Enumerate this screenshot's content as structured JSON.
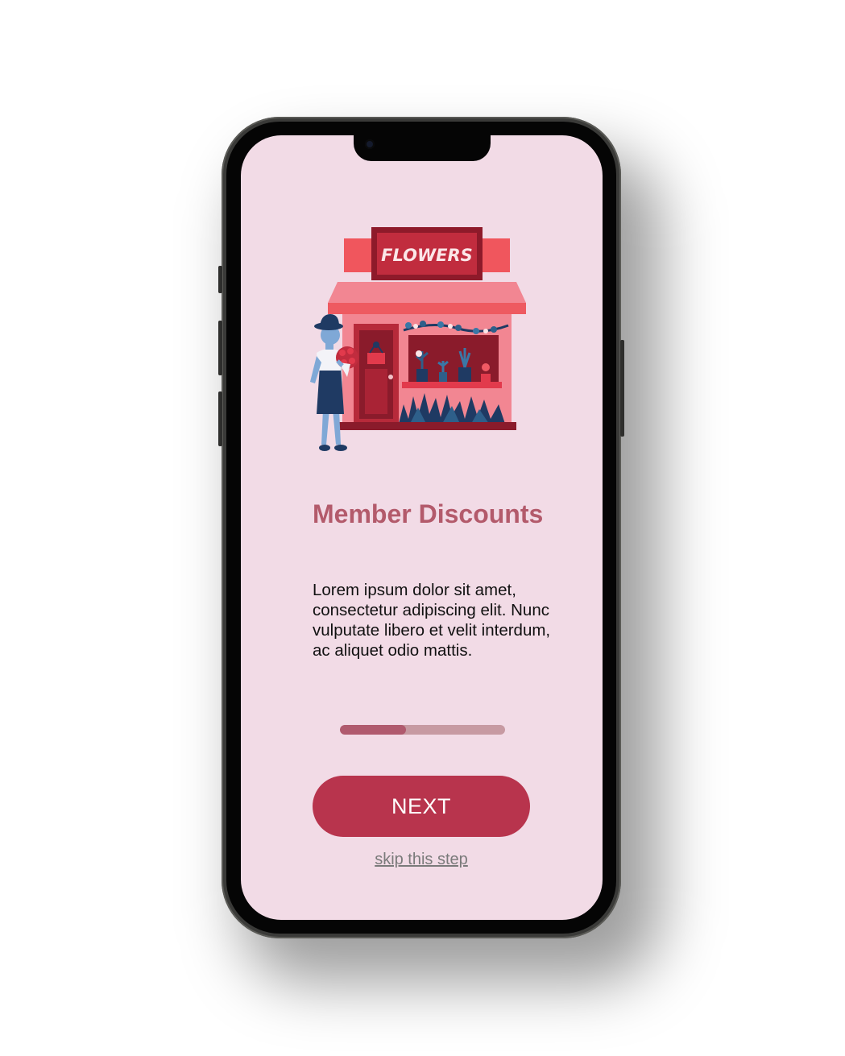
{
  "illustration": {
    "sign_text": "FLOWERS"
  },
  "onboarding": {
    "title": "Member Discounts",
    "description": "Lorem ipsum dolor sit amet, consectetur adipiscing elit. Nunc vulputate libero et velit interdum, ac aliquet odio mattis.",
    "progress_fraction": 0.4,
    "next_label": "NEXT",
    "skip_label": "skip this step"
  },
  "colors": {
    "screen_background": "#f2dbe6",
    "accent": "#b8344d",
    "title": "#b35a6b",
    "progress_track": "#c79aa2",
    "progress_fill": "#b05a6e"
  }
}
